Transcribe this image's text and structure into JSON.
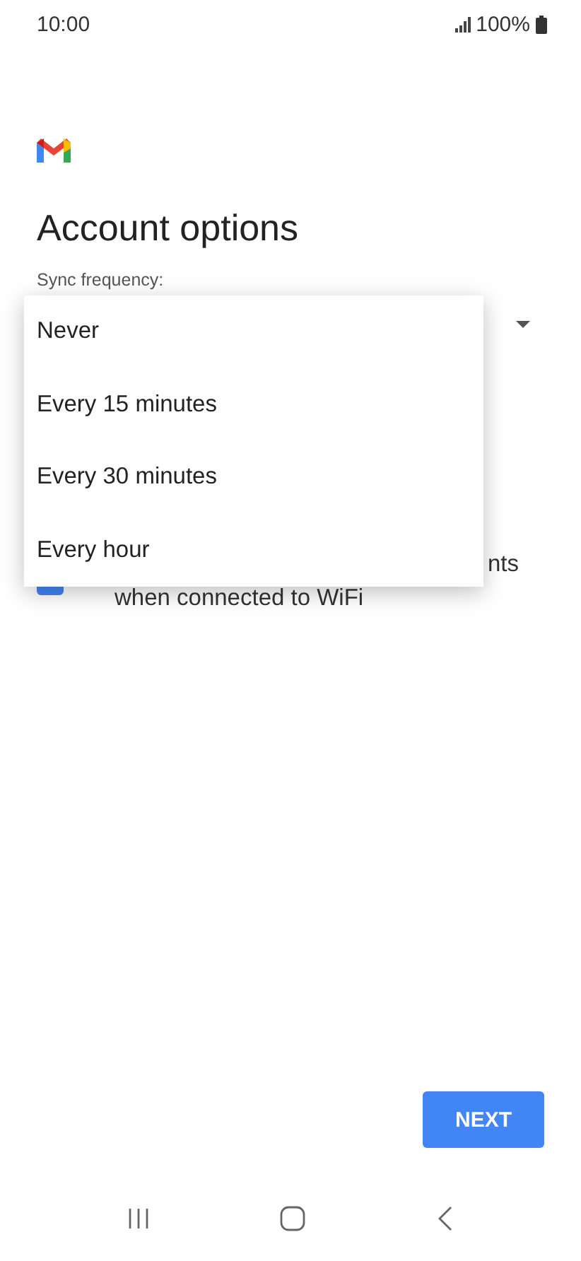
{
  "status_bar": {
    "time": "10:00",
    "battery": "100%"
  },
  "title": "Account options",
  "sync_label": "Sync frequency:",
  "menu": {
    "options": [
      {
        "label": "Never",
        "selected": false
      },
      {
        "label": "Every 15 minutes",
        "selected": false
      },
      {
        "label": "Every 30 minutes",
        "selected": false
      },
      {
        "label": "Every hour",
        "selected": false
      }
    ]
  },
  "checkbox": {
    "checked": true,
    "label_lines": [
      "nts",
      "when connected to WiFi"
    ]
  },
  "next_button": "NEXT"
}
